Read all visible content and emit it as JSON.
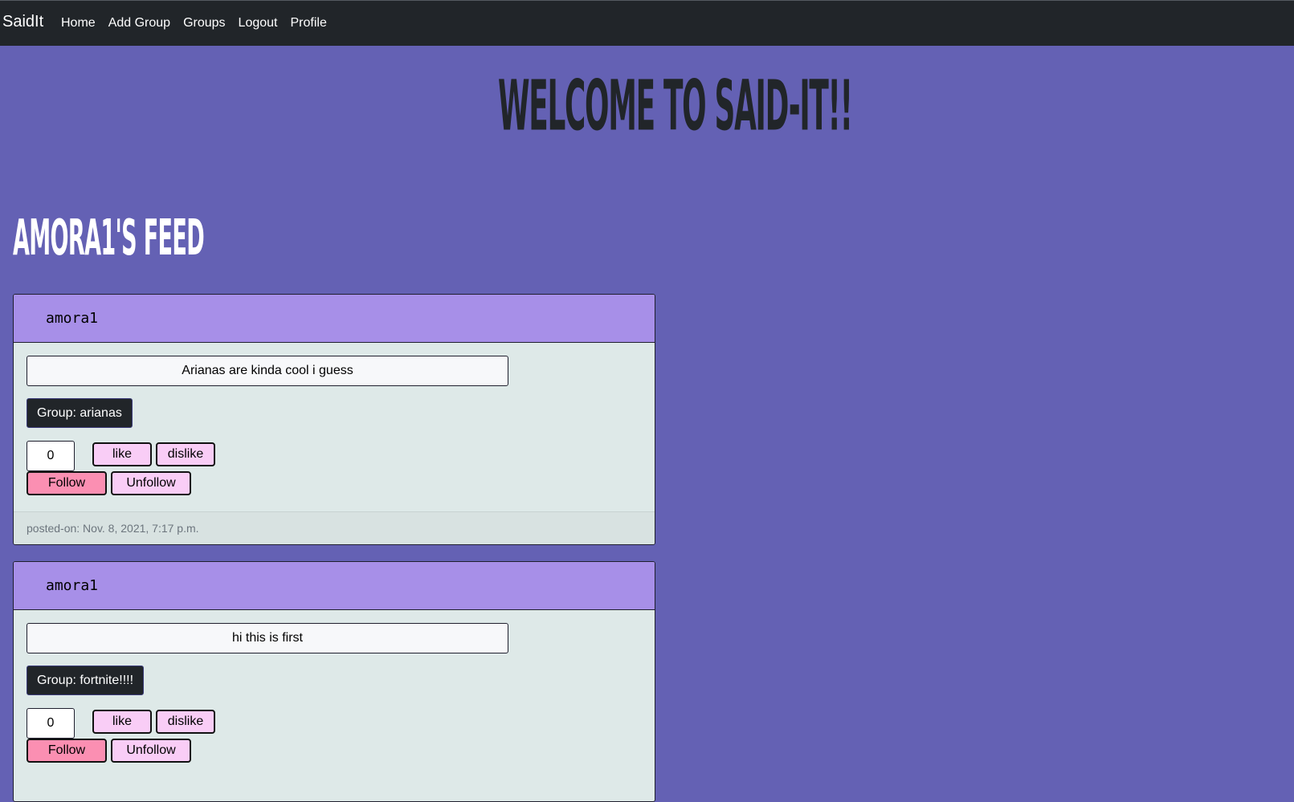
{
  "navbar": {
    "brand": "SaidIt",
    "links": [
      "Home",
      "Add Group",
      "Groups",
      "Logout",
      "Profile"
    ]
  },
  "hero": {
    "title": "Welcome to Said-It!!"
  },
  "feed": {
    "title": "amora1's feed",
    "posts": [
      {
        "author": "amora1",
        "text": "Arianas are kinda cool i guess",
        "group": "Group: arianas",
        "count": "0",
        "like_label": "like",
        "dislike_label": "dislike",
        "follow_label": "Follow",
        "unfollow_label": "Unfollow",
        "posted_on": "posted-on: Nov. 8, 2021, 7:17 p.m."
      },
      {
        "author": "amora1",
        "text": "hi this is first",
        "group": "Group: fortnite!!!!",
        "count": "0",
        "like_label": "like",
        "dislike_label": "dislike",
        "follow_label": "Follow",
        "unfollow_label": "Unfollow"
      }
    ]
  },
  "colors": {
    "page_bg": "#6461b4",
    "navbar_bg": "#212529",
    "card_header_bg": "#a78fe8",
    "card_body_bg": "#dee9e8",
    "button_pink": "#f9cdf6",
    "follow_pink": "#fb8fb2"
  }
}
